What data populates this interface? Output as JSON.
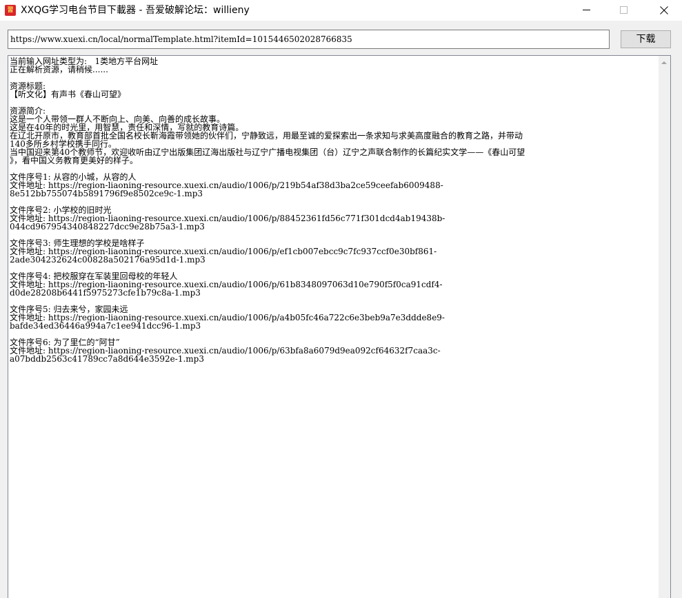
{
  "window": {
    "title": "XXQG学习电台节目下載器 - 吾爱破解论坛：willieny"
  },
  "toolbar": {
    "url_value": "https://www.xuexi.cn/local/normalTemplate.html?itemId=1015446502028766835",
    "download_label": "下载"
  },
  "output": {
    "lines": [
      "当前输入网址类型为:   1类地方平台网址",
      "正在解析资源，请稍候......",
      "",
      "资源标题:",
      "【听文化】有声书《春山可望》",
      "",
      "资源简介:",
      "这是一个人带领一群人不断向上、向美、向善的成长故事。",
      "这是在40年的时光里，用智慧，责任和深情，写就的教育诗篇。",
      "在辽北开原市，教育部首批全国名校长靳海霞带领她的伙伴们，宁静致远，用最至诚的爱探索出一条求知与求美高度融合的教育之路，并带动",
      "140多所乡村学校携手同行。",
      "当中国迎来第40个教师节，欢迎收听由辽宁出版集团辽海出版社与辽宁广播电视集团（台）辽宁之声联合制作的长篇纪实文学——《春山可望",
      "》，看中国义务教育更美好的样子。",
      "",
      "文件序号1: 从容的小城，从容的人",
      "文件地址: https://region-liaoning-resource.xuexi.cn/audio/1006/p/219b54af38d3ba2ce59ceefab6009488-",
      "8e512bb755074b5891796f9e8502ce9c-1.mp3",
      "",
      "文件序号2: 小学校的旧时光",
      "文件地址: https://region-liaoning-resource.xuexi.cn/audio/1006/p/88452361fd56c771f301dcd4ab19438b-",
      "044cd967954340848227dcc9e28b75a3-1.mp3",
      "",
      "文件序号3: 师生理想的学校是啥样子",
      "文件地址: https://region-liaoning-resource.xuexi.cn/audio/1006/p/ef1cb007ebcc9c7fc937ccf0e30bf861-",
      "2ade304232624c00828a502176a95d1d-1.mp3",
      "",
      "文件序号4: 把校服穿在军装里回母校的年轻人",
      "文件地址: https://region-liaoning-resource.xuexi.cn/audio/1006/p/61b8348097063d10e790f5f0ca91cdf4-",
      "d0de28208b6441f5975273cfe1b79c8a-1.mp3",
      "",
      "文件序号5: 归去来兮，家园未远",
      "文件地址: https://region-liaoning-resource.xuexi.cn/audio/1006/p/a4b05fc46a722c6e3beb9a7e3ddde8e9-",
      "bafde34ed36446a994a7c1ee941dcc96-1.mp3",
      "",
      "文件序号6: 为了里仁的“阿甘”",
      "文件地址: https://region-liaoning-resource.xuexi.cn/audio/1006/p/63bfa8a6079d9ea092cf64632f7caa3c-",
      "a07bddb2563c41789cc7a8d644e3592e-1.mp3"
    ]
  }
}
